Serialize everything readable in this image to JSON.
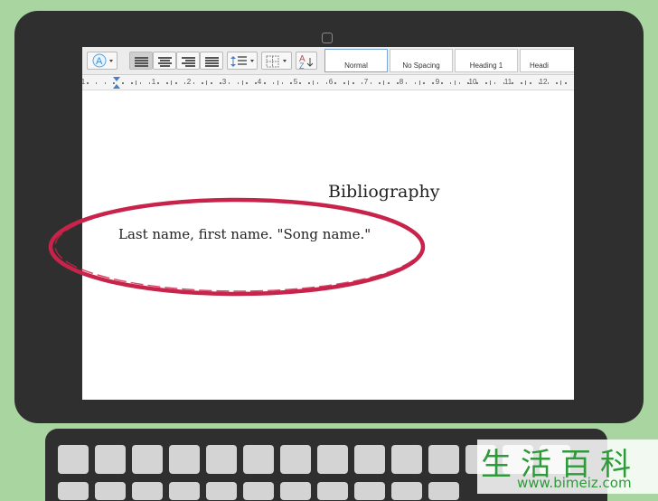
{
  "toolbar": {
    "styles": [
      {
        "label": "Normal"
      },
      {
        "label": "No Spacing"
      },
      {
        "label": "Heading 1"
      },
      {
        "label": "Headi"
      }
    ]
  },
  "ruler": {
    "numbers": [
      "1",
      "1",
      "2",
      "3",
      "4",
      "5",
      "6",
      "7",
      "8",
      "9",
      "10",
      "11",
      "12"
    ]
  },
  "document": {
    "title": "Bibliography",
    "entry": "Last name, first name. \"Song name.\""
  },
  "annotation": {
    "ellipse_color": "#c8234a"
  },
  "watermark": {
    "chars": "生活百科",
    "url": "www.bimeiz.com"
  },
  "colors": {
    "background": "#a8d5a0",
    "bezel": "#2f2f2f",
    "accent_blue": "#4a7fc1"
  },
  "icons": [
    "text-effects-icon",
    "align-left-icon",
    "align-center-icon",
    "align-right-icon",
    "justify-icon",
    "line-spacing-icon",
    "borders-icon",
    "styles-pane-icon",
    "webcam-icon"
  ]
}
